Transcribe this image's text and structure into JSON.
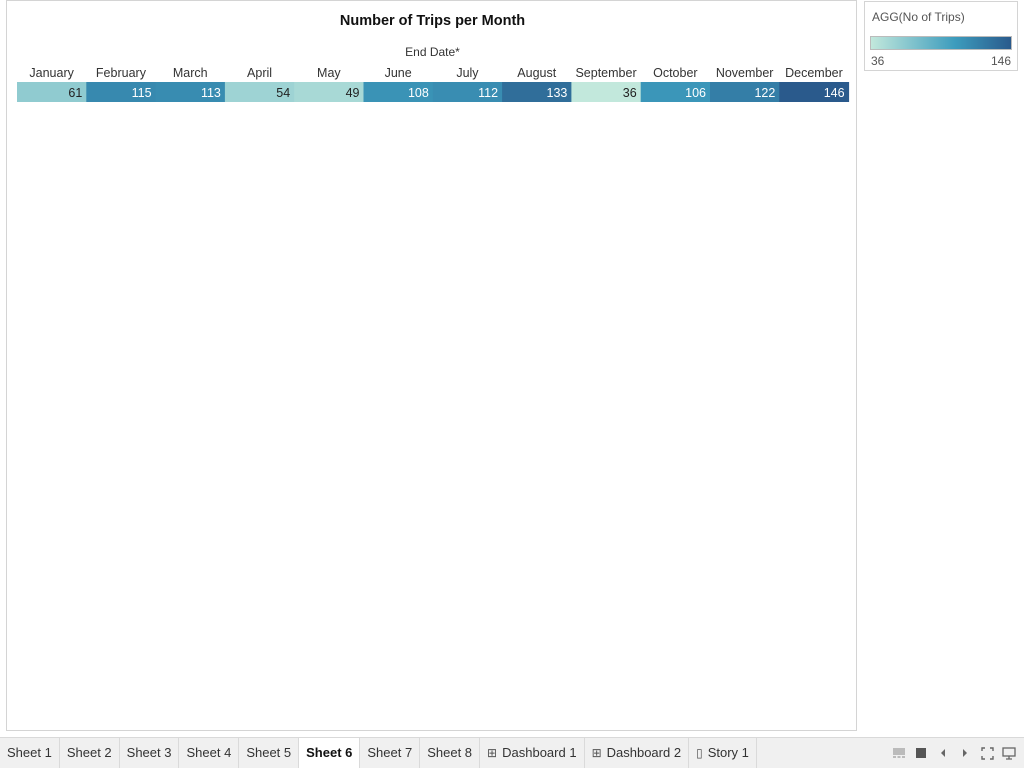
{
  "worksheet": {
    "title": "Number of Trips per Month",
    "column_header": "End Date*"
  },
  "legend": {
    "title": "AGG(No of Trips)",
    "min_label": "36",
    "max_label": "146"
  },
  "colors": {
    "low": "#c2e8dc",
    "mid": "#3d9cbd",
    "high": "#2a5a8c",
    "light_text": "#ffffff",
    "dark_text": "#222222"
  },
  "chart_data": {
    "type": "heatmap",
    "title": "Number of Trips per Month",
    "column_field": "End Date*",
    "measure": "AGG(No of Trips)",
    "categories": [
      "January",
      "February",
      "March",
      "April",
      "May",
      "June",
      "July",
      "August",
      "September",
      "October",
      "November",
      "December"
    ],
    "values": [
      61,
      115,
      113,
      54,
      49,
      108,
      112,
      133,
      36,
      106,
      122,
      146
    ],
    "color_range": [
      36,
      146
    ]
  },
  "tabs": [
    {
      "label": "Sheet 1",
      "icon": ""
    },
    {
      "label": "Sheet 2",
      "icon": ""
    },
    {
      "label": "Sheet 3",
      "icon": ""
    },
    {
      "label": "Sheet 4",
      "icon": ""
    },
    {
      "label": "Sheet 5",
      "icon": ""
    },
    {
      "label": "Sheet 6",
      "icon": "",
      "active": true
    },
    {
      "label": "Sheet 7",
      "icon": ""
    },
    {
      "label": "Sheet 8",
      "icon": ""
    },
    {
      "label": "Dashboard 1",
      "icon": "dashboard-icon"
    },
    {
      "label": "Dashboard 2",
      "icon": "dashboard-icon"
    },
    {
      "label": "Story 1",
      "icon": "story-icon"
    }
  ],
  "nav_icons": [
    "filmstrip-view-icon",
    "tabs-view-icon",
    "previous-sheet-icon",
    "next-sheet-icon",
    "fullscreen-icon",
    "presentation-mode-icon"
  ]
}
